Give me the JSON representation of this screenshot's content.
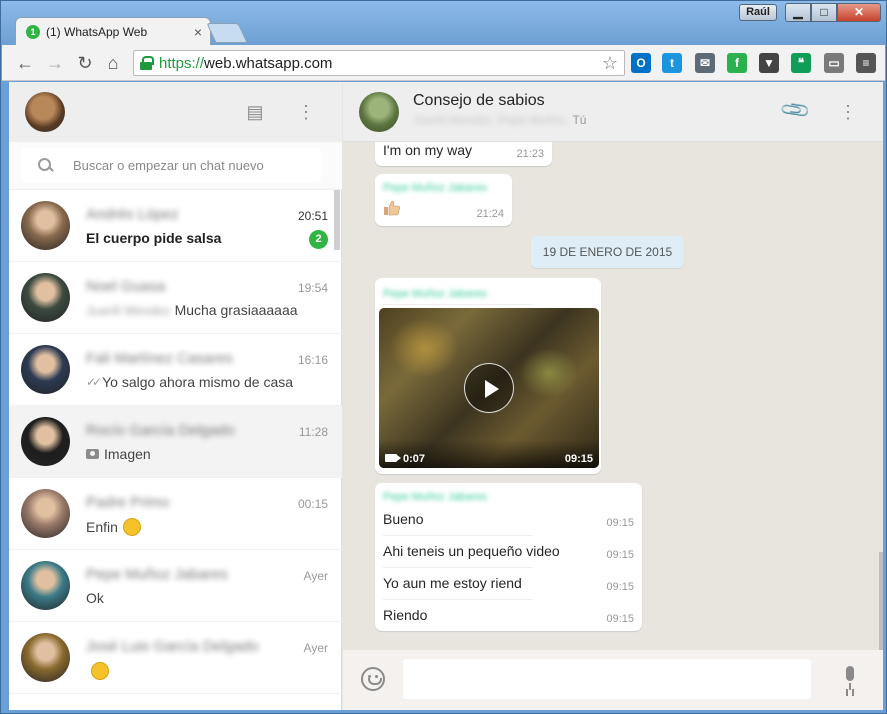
{
  "browser": {
    "tab_title": "(1) WhatsApp Web",
    "tab_badge": "1",
    "tab_close": "×",
    "user_name": "Raúl",
    "window_min": "▁",
    "window_max": "□",
    "window_close": "✕",
    "url_scheme": "https://",
    "url_host": "web.whatsapp.com",
    "nav": {
      "back": "←",
      "forward": "→",
      "reload": "↻",
      "home": "⌂"
    },
    "bookmark_icon": "☆",
    "extensions": [
      {
        "name": "outlook-icon",
        "label": "O",
        "color": "#0072c6"
      },
      {
        "name": "twitter-icon",
        "label": "t",
        "color": "#1b95e0"
      },
      {
        "name": "mail-icon",
        "label": "✉",
        "color": "#5d6b77"
      },
      {
        "name": "feedly-icon",
        "label": "f",
        "color": "#2bb24c"
      },
      {
        "name": "pocket-icon",
        "label": "▼",
        "color": "#444444"
      },
      {
        "name": "hangouts-icon",
        "label": "❝",
        "color": "#0f9d58"
      },
      {
        "name": "cast-icon",
        "label": "▭",
        "color": "#7a7a7a"
      },
      {
        "name": "menu-icon",
        "label": "≡",
        "color": "#555555"
      }
    ]
  },
  "sidebar": {
    "new_chat_icon": "▤",
    "menu_icon": "⋮",
    "search_placeholder": "Buscar o empezar un chat nuevo",
    "chats": [
      {
        "name": "Andrés López",
        "time": "20:51",
        "message": "El cuerpo pide salsa",
        "unread": "2",
        "avatar": "#8a6a4e",
        "bold": true
      },
      {
        "name": "Noel Guasa",
        "time": "19:54",
        "prefix": "Juanfi Mendez",
        "message": "Mucha grasiaaaaaa",
        "avatar": "#3c4a40"
      },
      {
        "name": "Fali Martínez Casares",
        "time": "16:16",
        "message": "Yo salgo ahora mismo de casa",
        "ticks": "✓✓",
        "avatar": "#2c3a52"
      },
      {
        "name": "Rocío García Delgado",
        "time": "11:28",
        "message": "Imagen",
        "camera": true,
        "avatar": "#1e1e1e",
        "active": true
      },
      {
        "name": "Padre Primo",
        "time": "00:15",
        "message": "Enfin",
        "emoji": true,
        "avatar": "#9a7a6a"
      },
      {
        "name": "Pepe Muñoz Jabares",
        "time": "Ayer",
        "message": "Ok",
        "avatar": "#3a7a88"
      },
      {
        "name": "José Luis García Delgado",
        "time": "Ayer",
        "message": "",
        "emoji": true,
        "avatar": "#8a6a2e"
      }
    ]
  },
  "conversation": {
    "title": "Consejo de sabios",
    "members_blurred": "Juanfi Mendez, Pepe Muñoz,",
    "members_you": "Tú",
    "attach_icon": "📎",
    "menu_icon": "⋮",
    "messages": {
      "m1": {
        "text": "I'm on my way",
        "time": "21:23"
      },
      "m2": {
        "sender": "Pepe Muñoz Jabares",
        "time": "21:24"
      },
      "date": "19 DE ENERO DE 2015",
      "video": {
        "sender": "Pepe Muñoz Jabares",
        "duration": "0:07",
        "time": "09:15"
      },
      "text_group": {
        "sender": "Pepe Muñoz Jabares",
        "lines": [
          {
            "text": "Bueno",
            "time": "09:15"
          },
          {
            "text": "Ahi teneis un pequeño video",
            "time": "09:15"
          },
          {
            "text": "Yo aun me estoy riend",
            "time": "09:15"
          },
          {
            "text": "Riendo",
            "time": "09:15"
          }
        ]
      }
    },
    "input_value": ""
  }
}
